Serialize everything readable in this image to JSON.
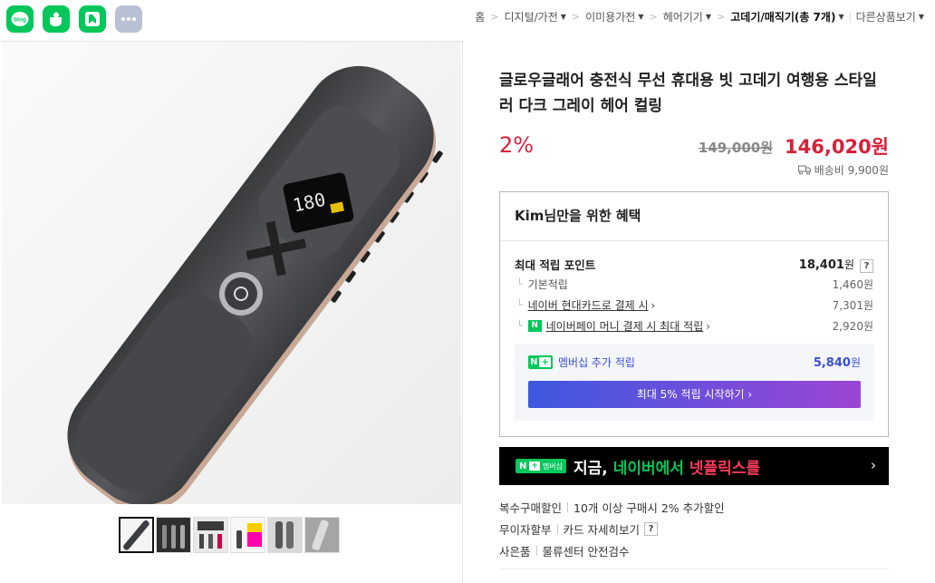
{
  "share": [
    {
      "name": "blog",
      "label": "blog",
      "color": "#03c75a"
    },
    {
      "name": "cafe",
      "color": "#03c75a"
    },
    {
      "name": "band",
      "color": "#03c75a"
    },
    {
      "name": "more",
      "color": "#b8c0d3"
    }
  ],
  "breadcrumb": {
    "items": [
      "홈",
      "디지털/가전",
      "이미용가전",
      "헤어기기"
    ],
    "current": "고데기/매직기(총 7개)",
    "other": "다른상품보기"
  },
  "device": {
    "display_text": "180"
  },
  "product": {
    "title": "글로우글래어 충전식 무선 휴대용 빗 고데기 여행용 스타일러 다크 그레이 헤어 컬링",
    "discount": "2%",
    "original_price": "149,000원",
    "price": "146,020원",
    "shipping": "배송비 9,900원"
  },
  "benefit": {
    "title": "Kim님만을 위한 혜택",
    "max_points_label": "최대 적립 포인트",
    "max_points_value": "18,401",
    "won": "원",
    "help": "?",
    "rows": [
      {
        "label": "기본적립",
        "value": "1,460원"
      },
      {
        "label": "네이버 현대카드로 결제 시",
        "value": "7,301원"
      },
      {
        "label": "네이버페이 머니 결제 시 최대 적립",
        "value": "2,920원"
      }
    ],
    "membership_label": "멤버십 추가 적립",
    "membership_value": "5,840",
    "start_button": "최대 5% 적립 시작하기 ›"
  },
  "banner": {
    "badge_n": "N",
    "badge_plus": "+",
    "badge_text": "멤버십",
    "text_1": "지금, ",
    "text_2": "네이버에서 ",
    "text_3": "넷플릭스를",
    "chevron": "›"
  },
  "extras": [
    {
      "label": "복수구매할인",
      "value": "10개 이상 구매시 2% 추가할인"
    },
    {
      "label": "무이자할부",
      "value": "카드 자세히보기"
    },
    {
      "label": "사은품",
      "value": "물류센터 안전검수"
    }
  ],
  "colors": {
    "accent_red": "#d8203b",
    "naver_green": "#03c75a",
    "membership_blue": "#3a4fd8"
  }
}
